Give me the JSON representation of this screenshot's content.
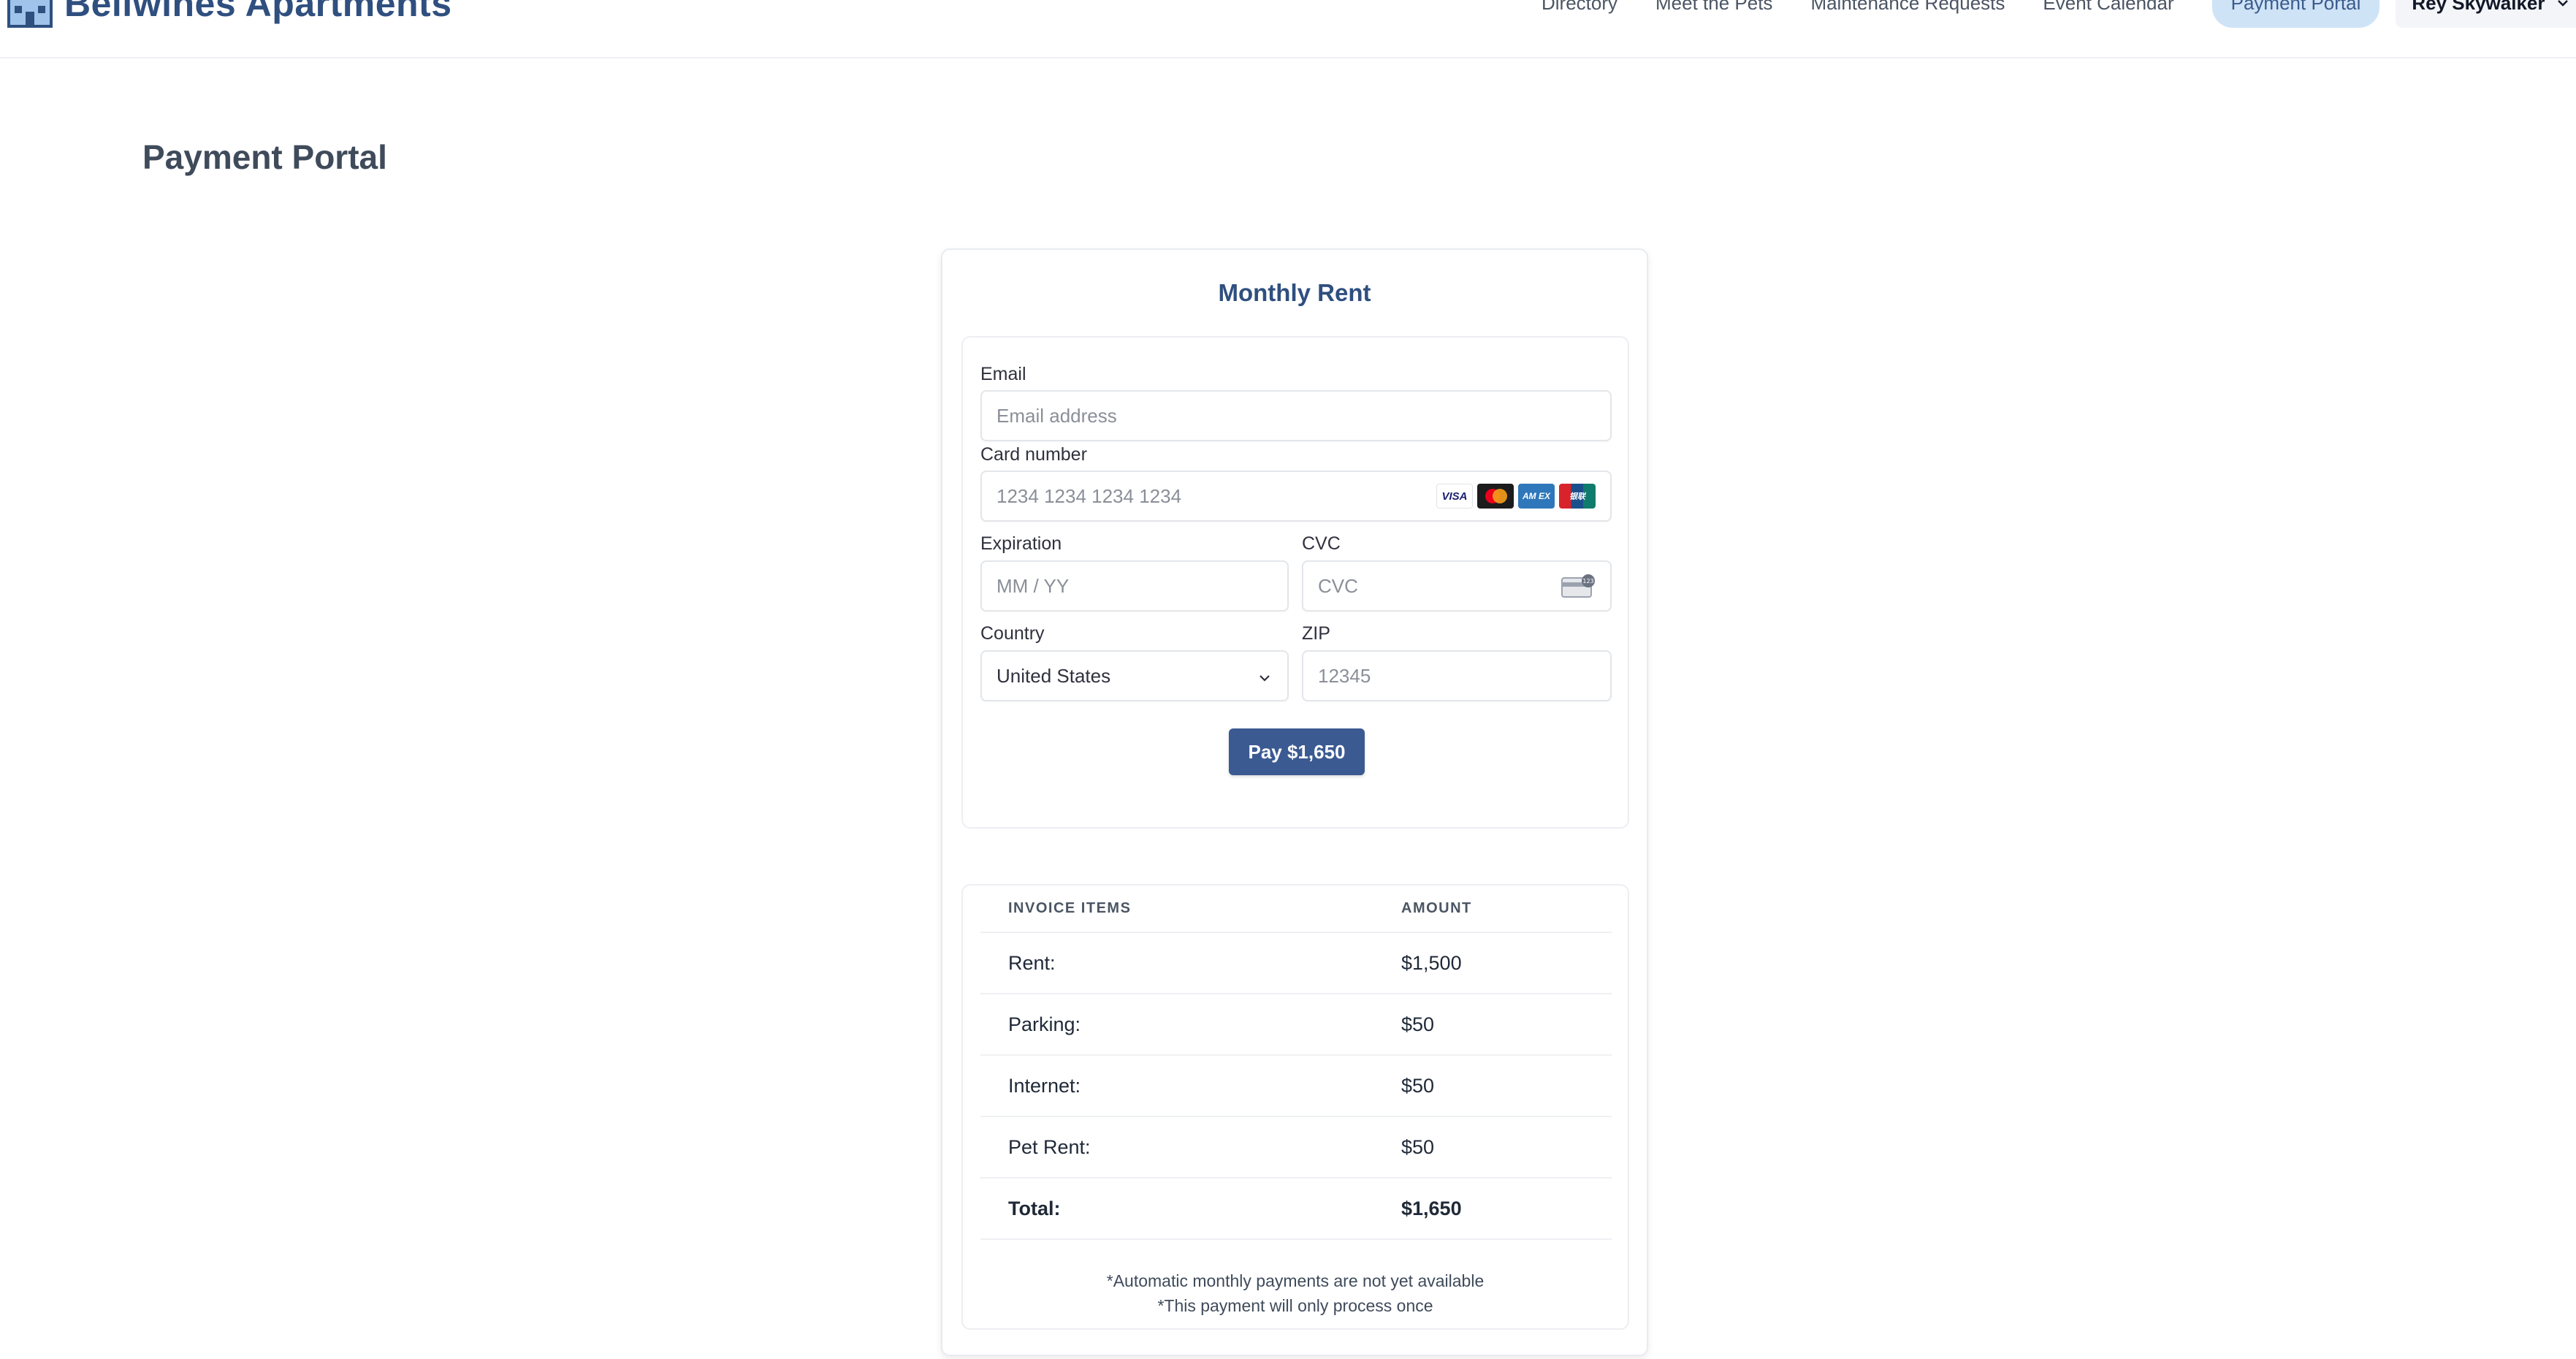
{
  "header": {
    "brand_name": "Bellwines Apartments",
    "brand_icon": "building-icon",
    "nav": [
      {
        "label": "Directory"
      },
      {
        "label": "Meet the Pets"
      },
      {
        "label": "Maintenance Requests"
      },
      {
        "label": "Event Calendar"
      },
      {
        "label": "Payment Portal",
        "active": true
      }
    ],
    "user_name": "Rey Skywalker"
  },
  "page": {
    "title": "Payment Portal"
  },
  "card": {
    "title": "Monthly Rent",
    "form": {
      "email_label": "Email",
      "email_placeholder": "Email address",
      "card_number_label": "Card number",
      "card_number_placeholder": "1234 1234 1234 1234",
      "card_brands": [
        "VISA",
        "Mastercard",
        "AMEX",
        "UnionPay"
      ],
      "card_brand_text": {
        "visa": "VISA",
        "amex": "AM EX",
        "unionpay": "银联"
      },
      "expiration_label": "Expiration",
      "expiration_placeholder": "MM / YY",
      "cvc_label": "CVC",
      "cvc_placeholder": "CVC",
      "country_label": "Country",
      "country_value": "United States",
      "zip_label": "ZIP",
      "zip_placeholder": "12345",
      "pay_button": "Pay $1,650"
    },
    "invoice": {
      "headers": [
        "INVOICE ITEMS",
        "AMOUNT"
      ],
      "rows": [
        {
          "item": "Rent:",
          "amount": "$1,500"
        },
        {
          "item": "Parking:",
          "amount": "$50"
        },
        {
          "item": "Internet:",
          "amount": "$50"
        },
        {
          "item": "Pet Rent:",
          "amount": "$50"
        }
      ],
      "total": {
        "item": "Total:",
        "amount": "$1,650"
      },
      "notes": [
        "*Automatic monthly payments are not yet available",
        "*This payment will only process once"
      ]
    }
  },
  "colors": {
    "brand": "#2f4f7f",
    "primary_button": "#3b5a92",
    "active_nav_bg": "#cfe3f7"
  }
}
